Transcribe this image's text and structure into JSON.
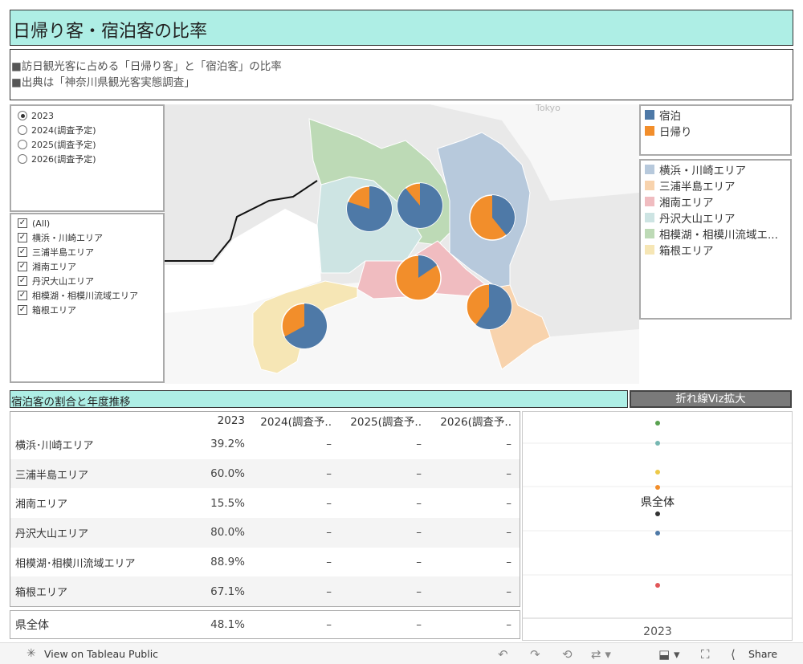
{
  "header": {
    "title": "日帰り客・宿泊客の比率",
    "desc_line1": "■訪日観光客に占める「日帰り客」と「宿泊客」の比率",
    "desc_line2": "■出典は「神奈川県観光客実態調査」"
  },
  "year_filter": {
    "options": [
      "2023",
      "2024(調査予定)",
      "2025(調査予定)",
      "2026(調査予定)"
    ],
    "selected": "2023"
  },
  "area_filter": {
    "items": [
      "(All)",
      "横浜・川崎エリア",
      "三浦半島エリア",
      "湘南エリア",
      "丹沢大山エリア",
      "相模湖・相模川流域エリア",
      "箱根エリア"
    ]
  },
  "map": {
    "label_tokyo": "Tokyo",
    "pies": [
      {
        "area": "丹沢大山エリア",
        "stay_ratio": 0.8
      },
      {
        "area": "相模湖・相模川流域エリア",
        "stay_ratio": 0.889
      },
      {
        "area": "横浜・川崎エリア",
        "stay_ratio": 0.392
      },
      {
        "area": "湘南エリア",
        "stay_ratio": 0.155
      },
      {
        "area": "三浦半島エリア",
        "stay_ratio": 0.6
      },
      {
        "area": "箱根エリア",
        "stay_ratio": 0.671
      }
    ]
  },
  "legend_type": {
    "items": [
      {
        "label": "宿泊",
        "color": "#4e79a7"
      },
      {
        "label": "日帰り",
        "color": "#f28e2b"
      }
    ]
  },
  "legend_area": {
    "items": [
      {
        "label": "横浜・川崎エリア",
        "color": "#b7c9dc"
      },
      {
        "label": "三浦半島エリア",
        "color": "#f8d3ad"
      },
      {
        "label": "湘南エリア",
        "color": "#f0bcc0"
      },
      {
        "label": "丹沢大山エリア",
        "color": "#cde4e3"
      },
      {
        "label": "相模湖・相模川流域エ...",
        "color": "#bddab6"
      },
      {
        "label": "箱根エリア",
        "color": "#f6e6b5"
      }
    ]
  },
  "section": {
    "title": "宿泊客の割合と年度推移",
    "zoom_button": "折れ線Viz拡大"
  },
  "table": {
    "columns": [
      "2023",
      "2024(調査予..",
      "2025(調査予..",
      "2026(調査予.."
    ],
    "rows": [
      {
        "name": "横浜･川崎エリア",
        "v2023": "39.2%",
        "v2024": "–",
        "v2025": "–",
        "v2026": "–"
      },
      {
        "name": "三浦半島エリア",
        "v2023": "60.0%",
        "v2024": "–",
        "v2025": "–",
        "v2026": "–"
      },
      {
        "name": "湘南エリア",
        "v2023": "15.5%",
        "v2024": "–",
        "v2025": "–",
        "v2026": "–"
      },
      {
        "name": "丹沢大山エリア",
        "v2023": "80.0%",
        "v2024": "–",
        "v2025": "–",
        "v2026": "–"
      },
      {
        "name": "相模湖･相模川流域エリア",
        "v2023": "88.9%",
        "v2024": "–",
        "v2025": "–",
        "v2026": "–"
      },
      {
        "name": "箱根エリア",
        "v2023": "67.1%",
        "v2024": "–",
        "v2025": "–",
        "v2026": "–"
      }
    ],
    "total": {
      "name": "県全体",
      "v2023": "48.1%",
      "v2024": "–",
      "v2025": "–",
      "v2026": "–"
    }
  },
  "dotplot": {
    "label": "県全体",
    "x_label": "2023",
    "dots": [
      {
        "color": "#59a14f"
      },
      {
        "color": "#76b7b2"
      },
      {
        "color": "#edc948"
      },
      {
        "color": "#f28e2b"
      },
      {
        "color": "#333333"
      },
      {
        "color": "#4e79a7"
      },
      {
        "color": "#e15759"
      }
    ]
  },
  "footer": {
    "view_label": "View on Tableau Public",
    "share_label": "Share"
  }
}
